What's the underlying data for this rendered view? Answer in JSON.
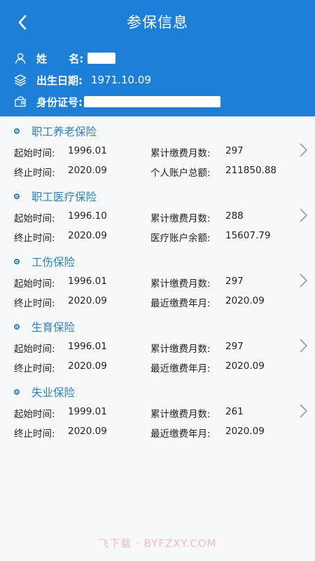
{
  "header": {
    "title": "参保信息",
    "name_label": "姓      名:",
    "birth_label": "出生日期:",
    "birth_value": "1971.10.09",
    "id_label": "身份证号:"
  },
  "insurances": [
    {
      "name": "职工养老保险",
      "start_label": "起始时间:",
      "start_value": "1996.01",
      "months_label": "累计缴费月数:",
      "months_value": "297",
      "end_label": "终止时间:",
      "end_value": "2020.09",
      "extra_label": "个人账户总额:",
      "extra_value": "211850.88"
    },
    {
      "name": "职工医疗保险",
      "start_label": "起始时间:",
      "start_value": "1996.10",
      "months_label": "累计缴费月数:",
      "months_value": "288",
      "end_label": "终止时间:",
      "end_value": "2020.09",
      "extra_label": "医疗账户余额:",
      "extra_value": "15607.79"
    },
    {
      "name": "工伤保险",
      "start_label": "起始时间:",
      "start_value": "1996.01",
      "months_label": "累计缴费月数:",
      "months_value": "297",
      "end_label": "终止时间:",
      "end_value": "2020.09",
      "extra_label": "最近缴费年月:",
      "extra_value": "2020.09"
    },
    {
      "name": "生育保险",
      "start_label": "起始时间:",
      "start_value": "1996.01",
      "months_label": "累计缴费月数:",
      "months_value": "297",
      "end_label": "终止时间:",
      "end_value": "2020.09",
      "extra_label": "最近缴费年月:",
      "extra_value": "2020.09"
    },
    {
      "name": "失业保险",
      "start_label": "起始时间:",
      "start_value": "1999.01",
      "months_label": "累计缴费月数:",
      "months_value": "261",
      "end_label": "终止时间:",
      "end_value": "2020.09",
      "extra_label": "最近缴费年月:",
      "extra_value": "2020.09"
    }
  ],
  "watermark": "飞下载 · BYFZXY.COM",
  "colors": {
    "header_bg": "#1d7fd6",
    "accent": "#2d7fb8",
    "page_bg": "#f7f8fa"
  }
}
